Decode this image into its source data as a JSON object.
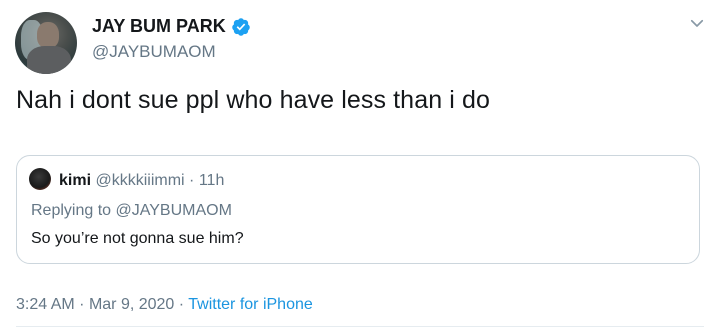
{
  "tweet": {
    "display_name": "JAY BUM PARK",
    "handle": "@JAYBUMAOM",
    "text": "Nah i dont sue ppl who have less than i do",
    "verified_icon": "verified-badge-icon",
    "menu_icon": "chevron-down-icon"
  },
  "quote": {
    "name": "kimi",
    "handle": "@kkkkiiimmi",
    "separator": "·",
    "time": "11h",
    "replying_prefix": "Replying to",
    "replying_to": "@JAYBUMAOM",
    "text": "So you’re not gonna sue him?"
  },
  "meta": {
    "time": "3:24 AM",
    "sep1": "·",
    "date": "Mar 9, 2020",
    "sep2": "·",
    "source": "Twitter for iPhone"
  },
  "colors": {
    "accent": "#1da1f2",
    "secondary_text": "#657786",
    "border": "#ccd6dd"
  }
}
